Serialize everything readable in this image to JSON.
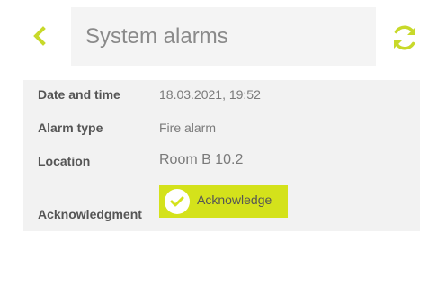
{
  "header": {
    "title": "System alarms",
    "back_icon": "chevron-left-icon",
    "refresh_icon": "refresh-icon"
  },
  "alarm": {
    "rows": [
      {
        "label": "Date and time",
        "value": "18.03.2021, 19:52"
      },
      {
        "label": "Alarm type",
        "value": "Fire alarm"
      },
      {
        "label": "Location",
        "value": "Room B 10.2"
      },
      {
        "label": "Acknowledgment",
        "value": ""
      }
    ],
    "acknowledge_label": "Acknowledge"
  },
  "colors": {
    "accent": "#d4e21b",
    "icon_green": "#c8d92a"
  }
}
